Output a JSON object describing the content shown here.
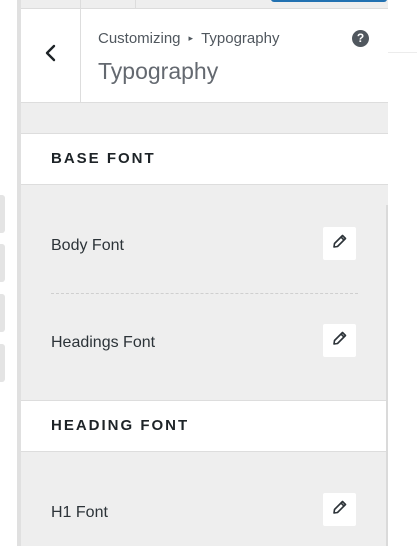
{
  "header": {
    "breadcrumb_parent": "Customizing",
    "breadcrumb_separator": "▸",
    "breadcrumb_current": "Typography",
    "title": "Typography",
    "help_label": "?"
  },
  "sections": [
    {
      "title": "BASE FONT",
      "items": [
        {
          "label": "Body Font"
        },
        {
          "label": "Headings Font"
        }
      ]
    },
    {
      "title": "HEADING FONT",
      "items": [
        {
          "label": "H1 Font"
        }
      ]
    }
  ],
  "colors": {
    "accent": "#2271b1",
    "panel_bg": "#eeeeee",
    "text": "#2c3338"
  },
  "icons": {
    "back": "chevron-left-icon",
    "help": "question-circle-icon",
    "edit": "pencil-icon"
  }
}
